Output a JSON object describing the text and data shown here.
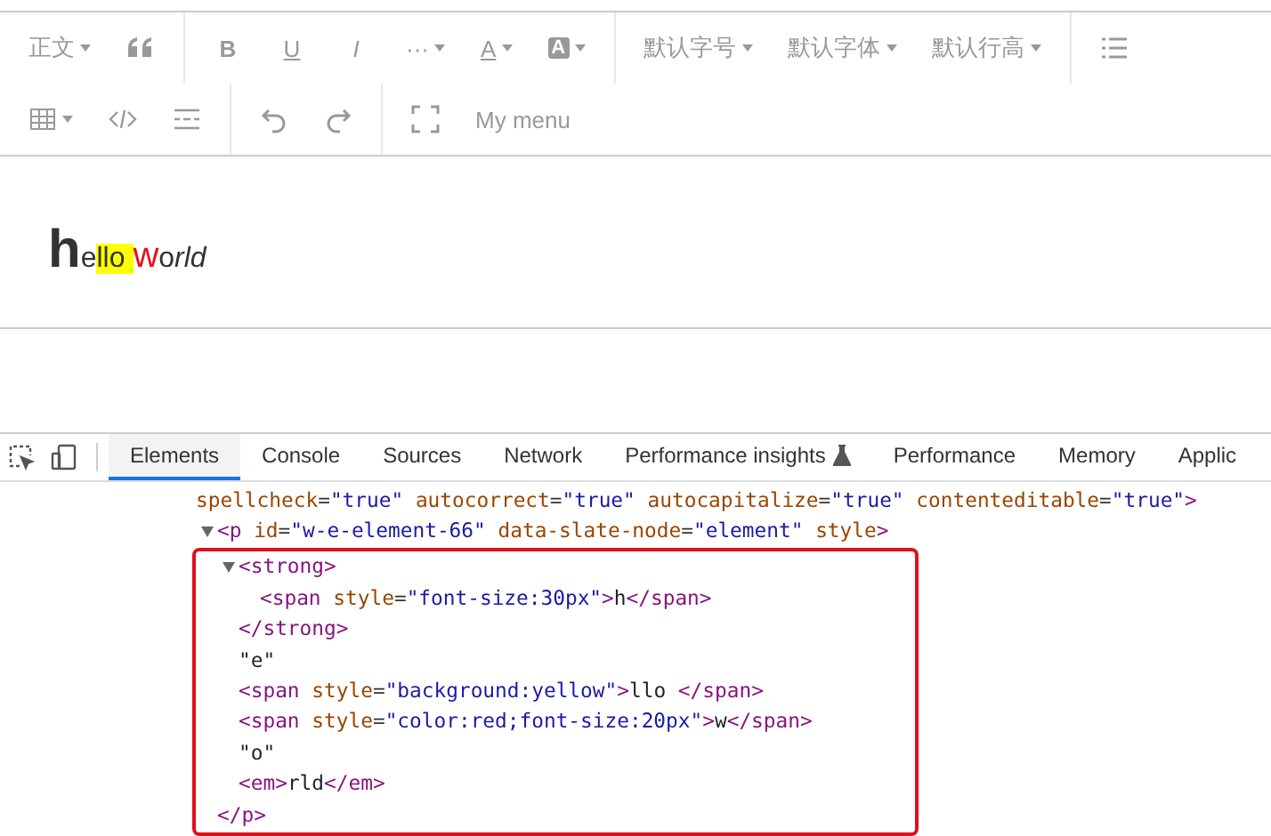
{
  "toolbar": {
    "rows": [
      {
        "groups": [
          [
            {
              "kind": "text",
              "label": "正文",
              "dropdown": true
            },
            {
              "kind": "quote",
              "dropdown": false
            }
          ],
          [
            {
              "kind": "text",
              "label": "B",
              "bold": true,
              "dropdown": false
            },
            {
              "kind": "text",
              "label": "U",
              "underline": true,
              "dropdown": false
            },
            {
              "kind": "text",
              "label": "I",
              "italic": true,
              "dropdown": false
            },
            {
              "kind": "text",
              "label": "···",
              "dropdown": true
            },
            {
              "kind": "text",
              "label": "A",
              "underline": true,
              "dropdown": true
            },
            {
              "kind": "boxed",
              "label": "A",
              "dropdown": true
            }
          ],
          [
            {
              "kind": "text",
              "label": "默认字号",
              "dropdown": true
            },
            {
              "kind": "text",
              "label": "默认字体",
              "dropdown": true
            },
            {
              "kind": "text",
              "label": "默认行高",
              "dropdown": true
            }
          ],
          [
            {
              "kind": "list",
              "dropdown": false
            }
          ]
        ]
      },
      {
        "groups": [
          [
            {
              "kind": "table",
              "dropdown": true
            },
            {
              "kind": "code",
              "dropdown": false
            },
            {
              "kind": "divider",
              "dropdown": false
            }
          ],
          [
            {
              "kind": "undo",
              "dropdown": false
            },
            {
              "kind": "redo",
              "dropdown": false
            }
          ],
          [
            {
              "kind": "fullscreen",
              "dropdown": false
            },
            {
              "kind": "text",
              "label": "My menu",
              "dropdown": false
            }
          ]
        ]
      }
    ]
  },
  "editor": {
    "runs": [
      {
        "text": "h",
        "bold": true,
        "italic": false,
        "large": true,
        "medium": false,
        "highlight": false,
        "color": "#333333"
      },
      {
        "text": "e",
        "bold": false,
        "italic": false,
        "large": false,
        "medium": false,
        "highlight": false,
        "color": "#333333"
      },
      {
        "text": "llo ",
        "bold": false,
        "italic": false,
        "large": false,
        "medium": false,
        "highlight": true
      },
      {
        "text": "w",
        "bold": false,
        "italic": false,
        "large": false,
        "medium": true,
        "highlight": false,
        "color": "#e8101c"
      },
      {
        "text": "o",
        "bold": false,
        "italic": false,
        "large": false,
        "medium": false,
        "highlight": false,
        "color": "#333333"
      },
      {
        "text": "rld",
        "bold": false,
        "italic": true,
        "large": false,
        "medium": false,
        "highlight": false,
        "color": "#333333"
      }
    ]
  },
  "devtools": {
    "tabs": [
      {
        "label": "Elements",
        "selected": true,
        "flask": false
      },
      {
        "label": "Console",
        "selected": false,
        "flask": false
      },
      {
        "label": "Sources",
        "selected": false,
        "flask": false
      },
      {
        "label": "Network",
        "selected": false,
        "flask": false
      },
      {
        "label": "Performance insights",
        "selected": false,
        "flask": true
      },
      {
        "label": "Performance",
        "selected": false,
        "flask": false
      },
      {
        "label": "Memory",
        "selected": false,
        "flask": false
      },
      {
        "label": "Applic",
        "selected": false,
        "flask": false
      }
    ],
    "attributes_line": [
      {
        "kind": "attr",
        "text": "spellcheck"
      },
      {
        "kind": "punct",
        "text": "="
      },
      {
        "kind": "value",
        "text": "\"true\""
      },
      {
        "kind": "attr",
        "text": " autocorrect"
      },
      {
        "kind": "punct",
        "text": "="
      },
      {
        "kind": "value",
        "text": "\"true\""
      },
      {
        "kind": "attr",
        "text": " autocapitalize"
      },
      {
        "kind": "punct",
        "text": "="
      },
      {
        "kind": "value",
        "text": "\"true\""
      },
      {
        "kind": "attr",
        "text": " contenteditable"
      },
      {
        "kind": "punct",
        "text": "="
      },
      {
        "kind": "value",
        "text": "\"true\""
      },
      {
        "kind": "tag",
        "text": ">"
      }
    ],
    "tree": [
      {
        "expanded": true,
        "boxed": true,
        "open": [
          {
            "kind": "tag",
            "text": "<p"
          },
          {
            "kind": "attr",
            "text": " id"
          },
          {
            "kind": "punct",
            "text": "="
          },
          {
            "kind": "value",
            "text": "\"w-e-element-66\""
          },
          {
            "kind": "attr",
            "text": " data-slate-node"
          },
          {
            "kind": "punct",
            "text": "="
          },
          {
            "kind": "value",
            "text": "\"element\""
          },
          {
            "kind": "attr",
            "text": " style"
          },
          {
            "kind": "tag",
            "text": ">"
          }
        ],
        "close": [
          {
            "kind": "tag",
            "text": "</p>"
          }
        ],
        "children": [
          {
            "expanded": true,
            "boxed": false,
            "open": [
              {
                "kind": "tag",
                "text": "<strong>"
              }
            ],
            "close": [
              {
                "kind": "tag",
                "text": "</strong>"
              }
            ],
            "children": [
              {
                "open": [
                  {
                    "kind": "tag",
                    "text": "<span"
                  },
                  {
                    "kind": "attr",
                    "text": " style"
                  },
                  {
                    "kind": "punct",
                    "text": "="
                  },
                  {
                    "kind": "value",
                    "text": "\"font-size:30px\""
                  },
                  {
                    "kind": "tag",
                    "text": ">"
                  },
                  {
                    "kind": "text",
                    "text": "h"
                  },
                  {
                    "kind": "tag",
                    "text": "</span>"
                  }
                ]
              }
            ]
          },
          {
            "open": [
              {
                "kind": "text",
                "text": "\"e\""
              }
            ]
          },
          {
            "open": [
              {
                "kind": "tag",
                "text": "<span"
              },
              {
                "kind": "attr",
                "text": " style"
              },
              {
                "kind": "punct",
                "text": "="
              },
              {
                "kind": "value",
                "text": "\"background:yellow\""
              },
              {
                "kind": "tag",
                "text": ">"
              },
              {
                "kind": "text",
                "text": "llo "
              },
              {
                "kind": "tag",
                "text": "</span>"
              }
            ]
          },
          {
            "open": [
              {
                "kind": "tag",
                "text": "<span"
              },
              {
                "kind": "attr",
                "text": " style"
              },
              {
                "kind": "punct",
                "text": "="
              },
              {
                "kind": "value",
                "text": "\"color:red;font-size:20px\""
              },
              {
                "kind": "tag",
                "text": ">"
              },
              {
                "kind": "text",
                "text": "w"
              },
              {
                "kind": "tag",
                "text": "</span>"
              }
            ]
          },
          {
            "open": [
              {
                "kind": "text",
                "text": "\"o\""
              }
            ]
          },
          {
            "open": [
              {
                "kind": "tag",
                "text": "<em>"
              },
              {
                "kind": "text",
                "text": "rld"
              },
              {
                "kind": "tag",
                "text": "</em>"
              }
            ]
          }
        ]
      }
    ]
  }
}
